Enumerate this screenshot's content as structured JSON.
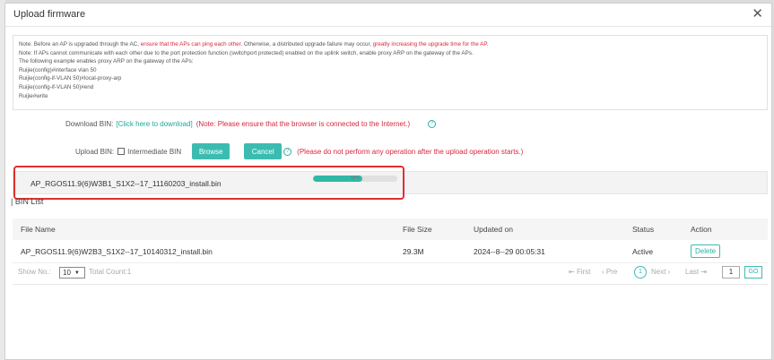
{
  "dialog": {
    "title": "Upload firmware",
    "close_icon": "close-icon"
  },
  "note": {
    "line1_a": "Note:  Before an AP is upgraded through the AC, ",
    "line1_b": "ensure that the APs can ping each other",
    "line1_c": ". Otherwise, a distributed upgrade failure may occur, ",
    "line1_d": "greatly increasing the upgrade time for the AP.",
    "line2": "Note: If APs cannot communicate with each other due to the port protection function (switchport protected) enabled on the uplink switch, enable proxy ARP on the gateway of the APs.",
    "line3": "The following example enables proxy ARP on the gateway of the APs:",
    "line4": "Ruijie(config)#interface vlan 50",
    "line5": "Ruijie(config-if-VLAN 50)#local-proxy-arp",
    "line6": "Ruijie(config-if-VLAN 50)#end",
    "line7": "Ruijie#write"
  },
  "download": {
    "label": "Download BIN:",
    "link": "[Click here to download]",
    "note": "(Note: Please ensure that the browser is connected to the Internet.)"
  },
  "upload": {
    "label": "Upload BIN:",
    "intermediate_label": "Intermediate BIN",
    "intermediate_checked": false,
    "browse": "Browse",
    "cancel": "Cancel",
    "warning": "(Please do not perform any operation after the upload operation starts.)"
  },
  "upload_progress": {
    "file_name": "AP_RGOS11.9(6)W3B1_S1X2--17_11160203_install.bin",
    "percent": 58,
    "percent_text": "58%"
  },
  "bin_list": {
    "title": "BIN List",
    "columns": [
      "File Name",
      "File Size",
      "Updated on",
      "Status",
      "Action"
    ],
    "rows": [
      {
        "file_name": "AP_RGOS11.9(6)W2B3_S1X2--17_10140312_install.bin",
        "file_size": "29.3M",
        "updated_on": "2024--8--29 00:05:31",
        "status": "Active",
        "action": "Delete"
      }
    ]
  },
  "pagination": {
    "show_no_label": "Show No.:",
    "page_size": "10",
    "total_count": "Total Count:1",
    "first": "First",
    "prev": "Pre",
    "current": "1",
    "next": "Next",
    "last": "Last",
    "goto_value": "1",
    "go": "GO"
  },
  "colors": {
    "accent": "#3cbcb0",
    "warning": "#d9263b",
    "highlight_border": "#e0302f"
  }
}
